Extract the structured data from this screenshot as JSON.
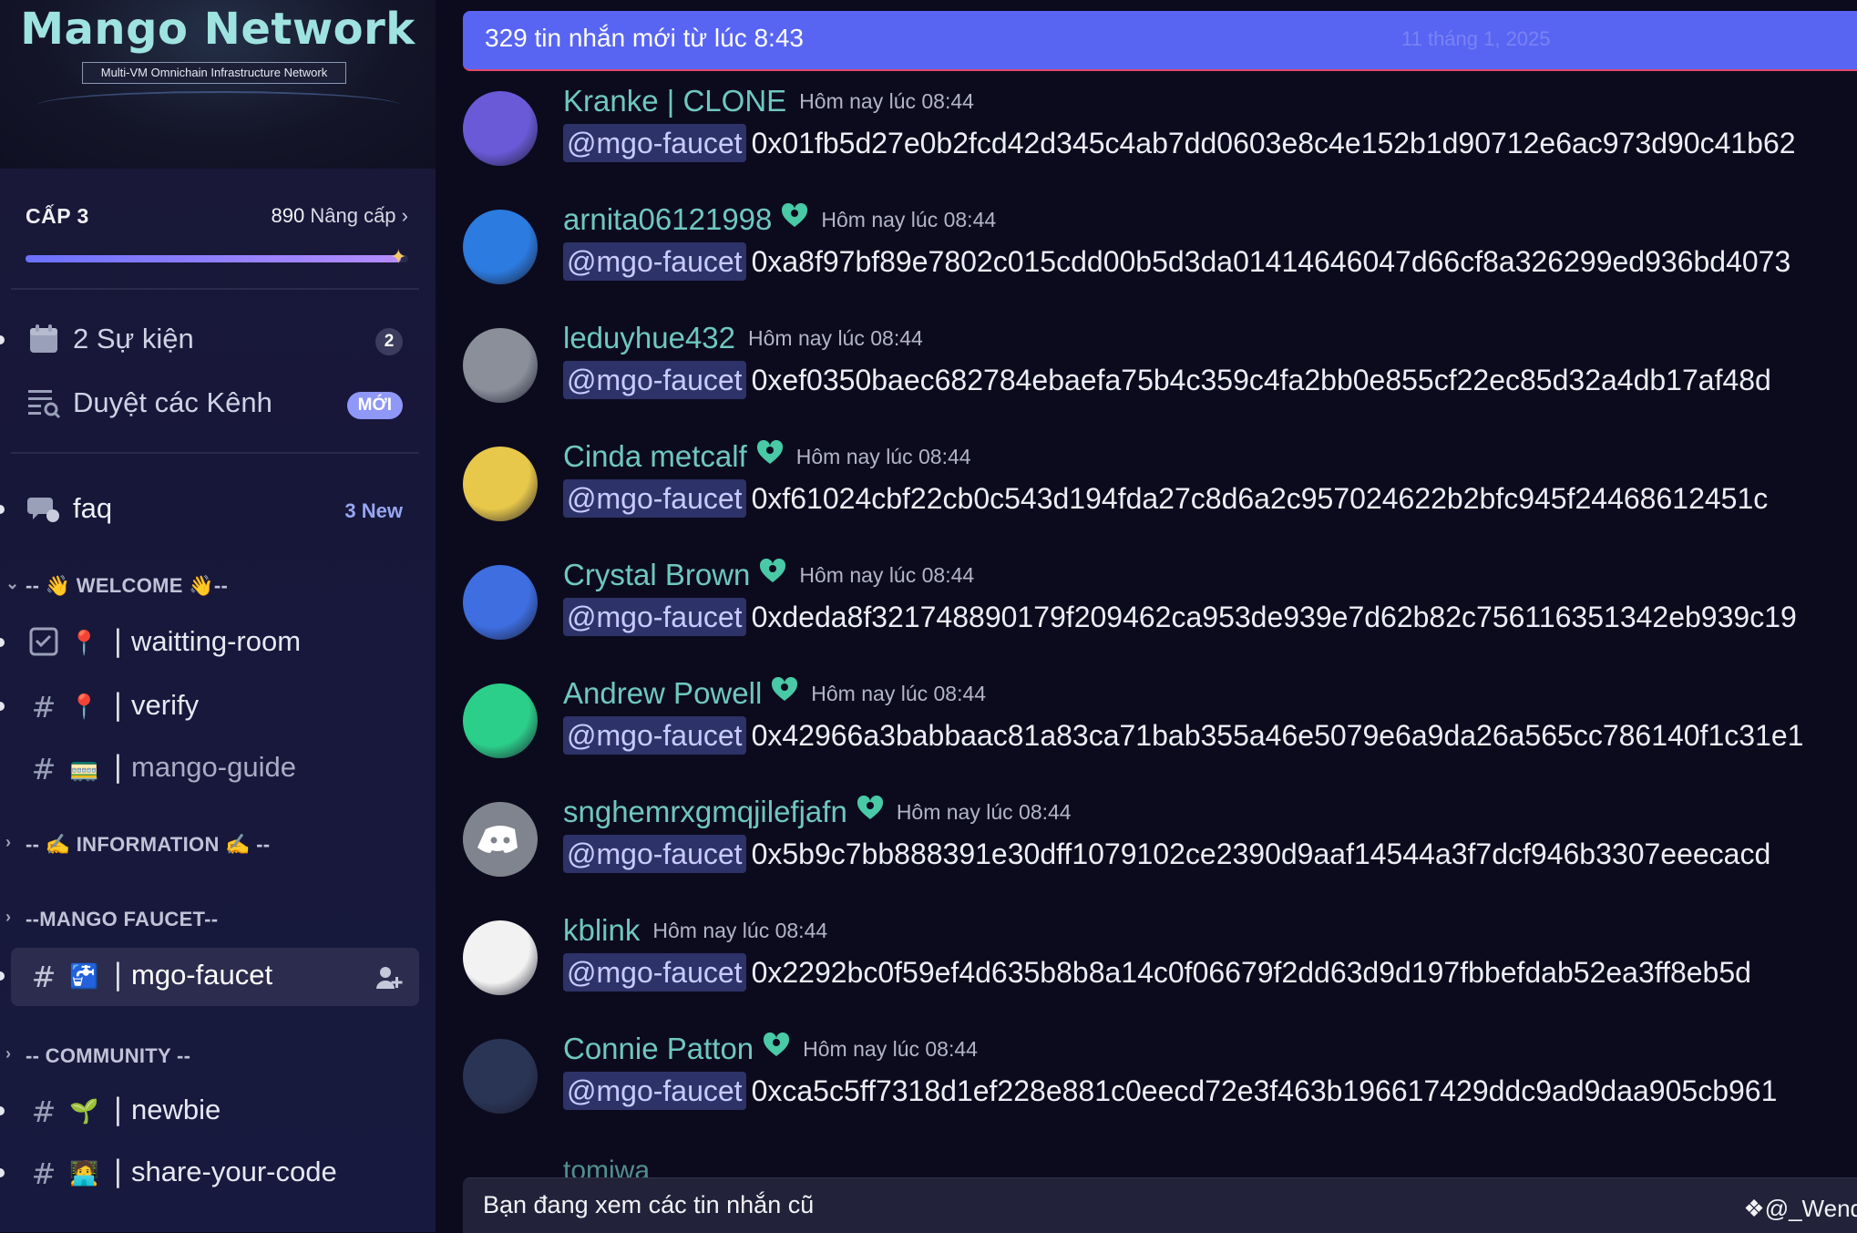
{
  "server": {
    "name": "Mango Network",
    "tagline": "Multi-VM Omnichain Infrastructure Network"
  },
  "level": {
    "label": "CẤP 3",
    "points": "890",
    "upgrade": "Nâng cấp",
    "progress": 0.98
  },
  "sidebar": {
    "events_label": "2 Sự kiện",
    "events_count": "2",
    "browse_label": "Duyệt các Kênh",
    "browse_badge": "MỚI",
    "faq_label": "faq",
    "faq_new": "3 New",
    "categories": {
      "welcome": "-- 👋 WELCOME 👋--",
      "information": "-- ✍️ INFORMATION ✍️ --",
      "mango_faucet": "--MANGO FAUCET--",
      "community": "-- COMMUNITY --"
    },
    "channels": {
      "waitting_room": "waitting-room",
      "verify": "verify",
      "mango_guide": "mango-guide",
      "mgo_faucet": "mgo-faucet",
      "newbie": "newbie",
      "share_your_code": "share-your-code"
    },
    "pipe": "|"
  },
  "main": {
    "new_messages_bar": "329 tin nhắn mới từ lúc 8:43",
    "new_messages_date": "11 tháng 1, 2025",
    "old_messages_notice": "Bạn đang xem các tin nhắn cũ",
    "watermark": "@_Wendy",
    "partial_user": "tomiwa",
    "messages": [
      {
        "user": "Kranke | CLONE",
        "boost": false,
        "time": "Hôm nay lúc 08:44",
        "mention": "@mgo-faucet",
        "text": "0x01fb5d27e0b2fcd42d345c4ab7dd0603e8c4e152b1d90712e6ac973d90c41b62",
        "avatar_color": "#6a5ad8"
      },
      {
        "user": "arnita06121998",
        "boost": true,
        "time": "Hôm nay lúc 08:44",
        "mention": "@mgo-faucet",
        "text": "0xa8f97bf89e7802c015cdd00b5d3da01414646047d66cf8a326299ed936bd4073",
        "avatar_color": "#2c7be0"
      },
      {
        "user": "leduyhue432",
        "boost": false,
        "time": "Hôm nay lúc 08:44",
        "mention": "@mgo-faucet",
        "text": "0xef0350baec682784ebaefa75b4c359c4fa2bb0e855cf22ec85d32a4db17af48d",
        "avatar_color": "#8a8f9a"
      },
      {
        "user": "Cinda metcalf",
        "boost": true,
        "time": "Hôm nay lúc 08:44",
        "mention": "@mgo-faucet",
        "text": "0xf61024cbf22cb0c543d194fda27c8d6a2c957024622b2bfc945f24468612451c",
        "avatar_color": "#e8c84a"
      },
      {
        "user": "Crystal Brown",
        "boost": true,
        "time": "Hôm nay lúc 08:44",
        "mention": "@mgo-faucet",
        "text": "0xdeda8f321748890179f209462ca953de939e7d62b82c756116351342eb939c19",
        "avatar_color": "#3e6ee0"
      },
      {
        "user": "Andrew Powell",
        "boost": true,
        "time": "Hôm nay lúc 08:44",
        "mention": "@mgo-faucet",
        "text": "0x42966a3babbaac81a83ca71bab355a46e5079e6a9da26a565cc786140f1c31e1",
        "avatar_color": "#2ccf8a"
      },
      {
        "user": "snghemrxgmqjilefjafn",
        "boost": true,
        "time": "Hôm nay lúc 08:44",
        "mention": "@mgo-faucet",
        "text": "0x5b9c7bb888391e30dff1079102ce2390d9aaf14544a3f7dcf946b3307eeecacd",
        "avatar_color": "#80848e"
      },
      {
        "user": "kblink",
        "boost": false,
        "time": "Hôm nay lúc 08:44",
        "mention": "@mgo-faucet",
        "text": "0x2292bc0f59ef4d635b8b8a14c0f06679f2dd63d9d197fbbefdab52ea3ff8eb5d",
        "avatar_color": "#f2f2f2"
      },
      {
        "user": "Connie Patton",
        "boost": true,
        "time": "Hôm nay lúc 08:44",
        "mention": "@mgo-faucet",
        "text": "0xca5c5ff7318d1ef228e881c0eecd72e3f463b196617429ddc9ad9daa905cb961",
        "avatar_color": "#2a3556"
      }
    ]
  },
  "colors": {
    "accent": "#5865f2",
    "username": "#6fc8bd",
    "mention_bg": "#2d3268",
    "sidebar_bg": "#17173a"
  }
}
